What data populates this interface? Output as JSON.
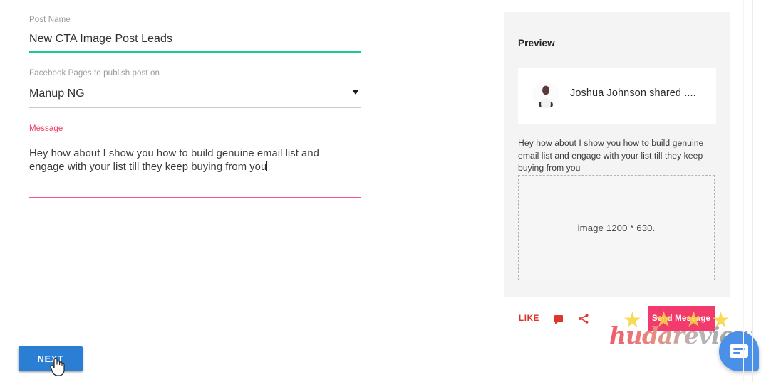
{
  "form": {
    "post_name": {
      "label": "Post Name",
      "value": "New CTA Image Post Leads"
    },
    "pages": {
      "label": "Facebook Pages to publish post on",
      "value": "Manup NG",
      "caret_icon": "chevron-down-icon"
    },
    "message": {
      "label": "Message",
      "value": "Hey how about I show you how to build genuine email list and engage with your list till they keep buying from you"
    },
    "next_button_label": "NEXT",
    "cursor_icon": "pointing-hand-cursor"
  },
  "preview": {
    "title": "Preview",
    "post_author": "Joshua Johnson shared ....",
    "avatar_icon": "user-avatar",
    "body_text": "Hey how about I show you how to build genuine email list and engage with your list till they keep buying from you",
    "image_placeholder": "image 1200 * 630."
  },
  "actions": {
    "like_label": "LIKE",
    "comment_icon": "comment-icon",
    "share_icon": "share-icon",
    "send_message_label": "Send Message",
    "star_icon": "star-icon"
  },
  "watermark": {
    "text": "hudareview"
  },
  "chat_widget": {
    "icon": "messenger-chat-icon"
  },
  "colors": {
    "accent_green": "#1ec88c",
    "accent_pink": "#f2557f",
    "label_pink": "#ec4067",
    "next_blue": "#2a7fd4",
    "send_message_pink": "#f23b6c",
    "action_red": "#d8352a",
    "chat_blue": "#4a90e8",
    "star_yellow": "#f7d84a",
    "panel_grey": "#f4f4f4"
  }
}
